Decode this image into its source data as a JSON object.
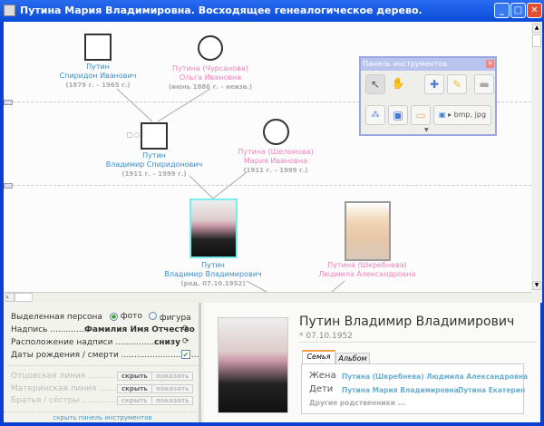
{
  "window": {
    "title": "Путина Мария Владимировна.  Восходящее генеалогическое дерево."
  },
  "tree": {
    "p1": {
      "line1": "Путин",
      "line2": "Спиридон Иванович",
      "dates": "(1879 г. – 1965 г.)"
    },
    "p2": {
      "line1": "Путина (Чурсанова)",
      "line2": "Ольга Ивановна",
      "dates": "(июнь 1886 г. – неизв.)"
    },
    "p3": {
      "line1": "Путин",
      "line2": "Владимир Спиридонович",
      "dates": "(1911 г. – 1999 г.)"
    },
    "p4": {
      "line1": "Путина (Шеломова)",
      "line2": "Мария Ивановна",
      "dates": "(1911 г. – 1999 г.)"
    },
    "p5": {
      "line1": "Путин",
      "line2": "Владимир Владимирович",
      "dates": "(род. 07.10.1952)"
    },
    "p6": {
      "line1": "Путина (Шкребнева)",
      "line2": "Людмила Александровна"
    }
  },
  "toolpanel": {
    "title": "Панель инструментов",
    "export_label": "▸ bmp, jpg"
  },
  "settings": {
    "selected_label": "Выделенная персона",
    "opt_photo": "фото",
    "opt_figure": "фигура",
    "selected_option": "фото",
    "caption_label": "Надпись ...............",
    "caption_value": "Фамилия Имя Отчество",
    "position_label": "Расположение надписи ...................",
    "position_value": "снизу",
    "dates_label": "Даты  рождения / смерти ..............................",
    "dates_checked": true,
    "paternal": "Отцовская линия ...............",
    "maternal": "Материнская линия ...........",
    "siblings": "Братья / сёстры ...............",
    "hide": "скрыть",
    "show": "показать",
    "hide_panel": "скрыть панель инструментов"
  },
  "details": {
    "name": "Путин Владимир Владимирович",
    "birth": "07.10.1952",
    "tabs": [
      {
        "label": "Семья",
        "active": true
      },
      {
        "label": "Альбом",
        "active": false
      }
    ],
    "wife_label": "Жена",
    "wife": "Путина (Шкребнева) Людмила Александровна",
    "children_label": "Дети",
    "child1": "Путина Мария Владимировна,",
    "child2": "Путина Екатерина",
    "other": "Другие родственники ..."
  }
}
